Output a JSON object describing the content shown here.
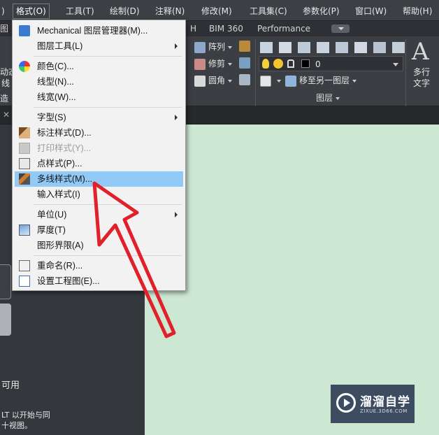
{
  "menubar": {
    "items": [
      {
        "label": ")"
      },
      {
        "label": "格式(O)"
      },
      {
        "label": "工具(T)"
      },
      {
        "label": "绘制(D)"
      },
      {
        "label": "注释(N)"
      },
      {
        "label": "修改(M)"
      },
      {
        "label": "工具集(C)"
      },
      {
        "label": "参数化(P)"
      },
      {
        "label": "窗口(W)"
      },
      {
        "label": "帮助(H)"
      }
    ]
  },
  "ribbon_tabs": {
    "left_fragment": "图",
    "items": [
      "H",
      "BIM 360",
      "Performance"
    ]
  },
  "ribbon": {
    "left_fragments": [
      "动态",
      "线",
      "造"
    ],
    "modify": {
      "array": "阵列",
      "trim": "修剪",
      "fillet": "圆角"
    },
    "layer": {
      "current_layer": "0",
      "move_to_layer": "移至另一图层",
      "panel_label": "图层"
    },
    "mtext": {
      "glyph": "A",
      "label_line1": "多行",
      "label_line2": "文字"
    },
    "colors": {
      "bg": "#3b3e43",
      "accent_blue": "#4aa3e6"
    }
  },
  "left_panel": {
    "available_text": "可用",
    "hint_line1": "LT 以开始与同",
    "hint_line2": "十视图。"
  },
  "format_menu": {
    "items": [
      {
        "label": "Mechanical 图层管理器(M)...",
        "icon": "layer-manager-icon"
      },
      {
        "label": "图层工具(L)",
        "submenu": true
      },
      {
        "label": "颜色(C)...",
        "icon": "color-wheel-icon"
      },
      {
        "label": "线型(N)..."
      },
      {
        "label": "线宽(W)..."
      },
      {
        "label": "字型(S)",
        "submenu": true
      },
      {
        "label": "标注样式(D)...",
        "icon": "dimension-style-icon"
      },
      {
        "label": "打印样式(Y)...",
        "icon": "plot-style-icon",
        "disabled": true
      },
      {
        "label": "点样式(P)...",
        "icon": "point-style-icon"
      },
      {
        "label": "多线样式(M)...",
        "icon": "multiline-style-icon",
        "highlighted": true
      },
      {
        "label": "输入样式(I)"
      },
      {
        "label": "单位(U)",
        "submenu": true
      },
      {
        "label": "厚度(T)",
        "icon": "thickness-icon"
      },
      {
        "label": "图形界限(A)"
      },
      {
        "label": "重命名(R)...",
        "icon": "rename-icon"
      },
      {
        "label": "设置工程图(E)...",
        "icon": "drawing-setup-icon"
      }
    ],
    "highlight_color": "#91c9f7"
  },
  "watermark": {
    "title": "溜溜自学",
    "subtitle": "ZIXUE.3D66.COM"
  },
  "annotation": {
    "arrow_color": "#e0202a"
  },
  "canvas": {
    "bg_color": "#cce8d2"
  }
}
